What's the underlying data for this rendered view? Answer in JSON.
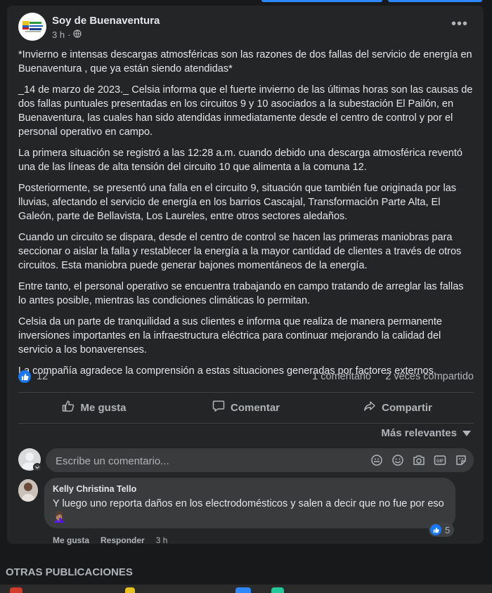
{
  "post": {
    "page_name": "Soy de Buenaventura",
    "time": "3 h",
    "privacy_icon": "globe-icon",
    "paragraphs": [
      "*Invierno e intensas descargas atmosféricas son las razones de dos fallas del servicio de energía en Buenaventura , que ya están siendo atendidas*",
      "_14 de marzo de 2023._ Celsia informa que el fuerte invierno de las últimas horas son las causas de dos fallas puntuales presentadas en los circuitos 9 y 10 asociados a la subestación El Pailón, en Buenaventura, las cuales han sido atendidas inmediatamente desde el centro de control y por el personal operativo en campo.",
      "La primera situación se registró a las 12:28 a.m. cuando debido una descarga atmosférica reventó una de las líneas de alta tensión del circuito 10 que alimenta a la comuna 12.",
      "Posteriormente, se presentó una falla en el circuito 9, situación que también fue originada por las lluvias, afectando el servicio de energía en los barrios Cascajal, Transformación Parte Alta, El Galeón, parte de Bellavista, Los Laureles, entre otros sectores aledaños.",
      "Cuando un circuito se dispara, desde el centro de control se hacen las primeras maniobras para seccionar o aislar la falla y restablecer la energía a la mayor cantidad de clientes a través de otros circuitos. Esta maniobra puede generar bajones momentáneos de la energía.",
      "Entre tanto, el personal operativo se encuentra trabajando en campo tratando de arreglar las fallas lo antes posible, mientras las condiciones climáticas lo permitan.",
      "Celsia da un parte de tranquilidad a sus clientes e informa que realiza de manera permanente inversiones importantes en la infraestructura eléctrica para continuar mejorando la calidad del servicio a los bonaverenses.",
      "La compañía agradece la comprensión a estas situaciones generadas por factores externos."
    ],
    "stats": {
      "likes": "12",
      "comments": "1 comentario",
      "shares": "2 veces compartido"
    },
    "actions": {
      "like": "Me gusta",
      "comment": "Comentar",
      "share": "Compartir"
    },
    "sort_label": "Más relevantes",
    "composer_placeholder": "Escribe un comentario...",
    "comment": {
      "author": "Kelly Christina Tello",
      "text": "Y luego uno reporta daños en los electrodomésticos y salen a decir que no fue por eso",
      "emoji": "🤦🏽‍♀️",
      "reactions": "5",
      "like_link": "Me gusta",
      "reply_link": "Responder",
      "time": "3 h"
    }
  },
  "section_title": "OTRAS PUBLICACIONES",
  "colors": {
    "background": "#18191a",
    "card": "#242526",
    "accent": "#1877f2",
    "text_primary": "#e4e6eb",
    "text_secondary": "#b0b3b8"
  }
}
